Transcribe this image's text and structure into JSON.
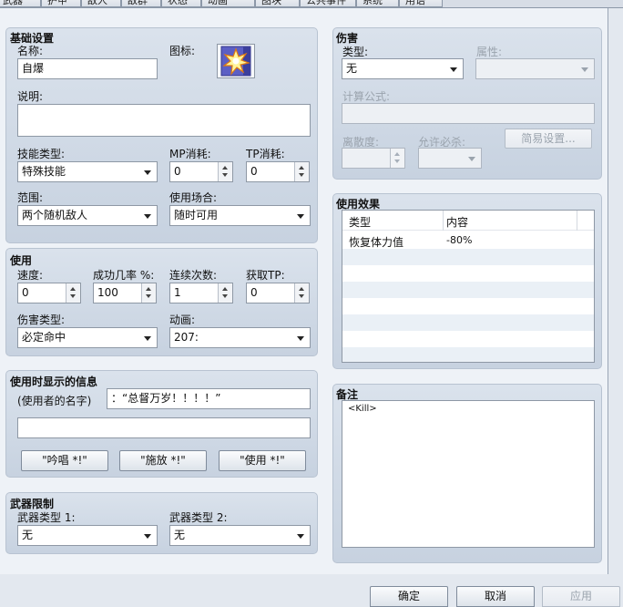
{
  "tabs": [
    "武器",
    "护甲",
    "敌人",
    "敌群",
    "状态",
    "动画",
    "图块",
    "公共事件",
    "系统",
    "用语"
  ],
  "basic": {
    "title": "基础设置",
    "name_label": "名称:",
    "name_value": "自爆",
    "icon_label": "图标:",
    "icon_name": "explosion-skill-icon",
    "desc_label": "说明:",
    "desc_value": "",
    "skill_type_label": "技能类型:",
    "skill_type_value": "特殊技能",
    "mp_label": "MP消耗:",
    "mp_value": "0",
    "tp_label": "TP消耗:",
    "tp_value": "0",
    "scope_label": "范围:",
    "scope_value": "两个随机敌人",
    "occasion_label": "使用场合:",
    "occasion_value": "随时可用"
  },
  "invocation": {
    "title": "使用",
    "speed_label": "速度:",
    "speed_value": "0",
    "success_label": "成功几率 %:",
    "success_value": "100",
    "repeat_label": "连续次数:",
    "repeat_value": "1",
    "tp_gain_label": "获取TP:",
    "tp_gain_value": "0",
    "hit_type_label": "伤害类型:",
    "hit_type_value": "必定命中",
    "animation_label": "动画:",
    "animation_value": "207:"
  },
  "message": {
    "title": "使用时显示的信息",
    "user_name_label": "(使用者的名字)",
    "line1": "：“总督万岁！！！！”",
    "line2": "",
    "btn_cast": "\"吟唱 *!\"",
    "btn_release": "\"施放 *!\"",
    "btn_use": "\"使用 *!\""
  },
  "weapon_req": {
    "title": "武器限制",
    "type1_label": "武器类型 1:",
    "type1_value": "无",
    "type2_label": "武器类型 2:",
    "type2_value": "无"
  },
  "damage": {
    "title": "伤害",
    "type_label": "类型:",
    "type_value": "无",
    "element_label": "属性:",
    "element_value": "",
    "formula_label": "计算公式:",
    "formula_value": "",
    "variance_label": "离散度:",
    "variance_value": "",
    "critical_label": "允许必杀:",
    "critical_value": "",
    "easy_button": "简易设置..."
  },
  "effects": {
    "title": "使用效果",
    "col_type": "类型",
    "col_content": "内容",
    "rows": [
      {
        "type": "恢复体力值",
        "content": "-80%"
      }
    ]
  },
  "note": {
    "title": "备注",
    "value": "<Kill>"
  },
  "footer": {
    "ok": "确定",
    "cancel": "取消",
    "apply": "应用"
  }
}
